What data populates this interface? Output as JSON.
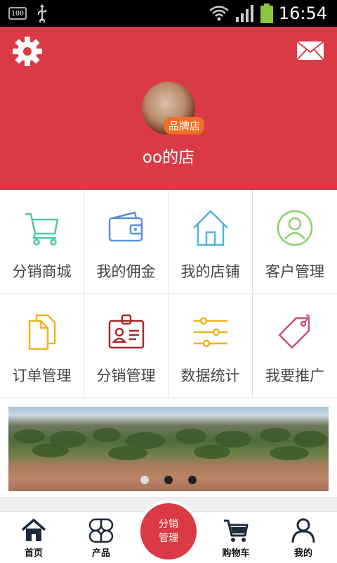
{
  "status_bar": {
    "battery_text": "100",
    "time": "16:54"
  },
  "header": {
    "badge": "品牌店",
    "shop_name": "oo的店"
  },
  "grid": [
    {
      "label": "分销商城",
      "icon": "shopping-cart-icon",
      "color": "#4fc7a6"
    },
    {
      "label": "我的佣金",
      "icon": "wallet-icon",
      "color": "#5b8fd9"
    },
    {
      "label": "我的店铺",
      "icon": "house-icon",
      "color": "#4fb7d6"
    },
    {
      "label": "客户管理",
      "icon": "user-circle-icon",
      "color": "#8ccf6c"
    },
    {
      "label": "订单管理",
      "icon": "document-icon",
      "color": "#f2b21e"
    },
    {
      "label": "分销管理",
      "icon": "id-card-icon",
      "color": "#a52a2a"
    },
    {
      "label": "数据统计",
      "icon": "sliders-icon",
      "color": "#f2b21e"
    },
    {
      "label": "我要推广",
      "icon": "tag-icon",
      "color": "#c8507e"
    }
  ],
  "banner": {
    "slides": 3,
    "active_index": 0
  },
  "bottom_nav": {
    "home": "首页",
    "products": "产品",
    "center_line1": "分销",
    "center_line2": "管理",
    "cart": "购物车",
    "mine": "我的"
  },
  "colors": {
    "brand_red": "#d93a45",
    "badge_orange": "#f26f24"
  }
}
